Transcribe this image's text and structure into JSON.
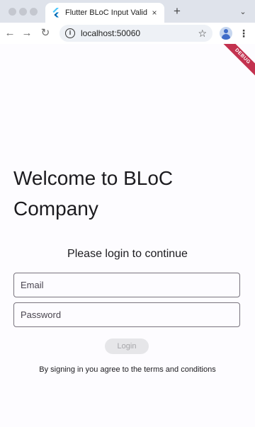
{
  "browser": {
    "tab_title": "Flutter BLoC Input Validations",
    "tab_close": "×",
    "new_tab": "+",
    "tab_menu": "⌄",
    "url": "localhost:50060",
    "icons": {
      "back": "←",
      "forward": "→",
      "reload": "↻",
      "info": "i",
      "star": "☆",
      "menu": "⋮"
    }
  },
  "debug_banner": "DEBUG",
  "app": {
    "welcome_line1": "Welcome to BLoC",
    "welcome_line2": "Company",
    "subtitle": "Please login to continue",
    "email_placeholder": "Email",
    "password_placeholder": "Password",
    "login_label": "Login",
    "terms": "By signing in you agree to the terms and conditions"
  },
  "colors": {
    "tab_strip": "#dfe3eb",
    "omnibox": "#eef1f6",
    "page_background": "#fdfcff",
    "field_border": "#79747e",
    "button_disabled_bg": "#e6e6e9",
    "button_disabled_text": "#a5a5a9",
    "debug_banner": "#b80e30"
  }
}
